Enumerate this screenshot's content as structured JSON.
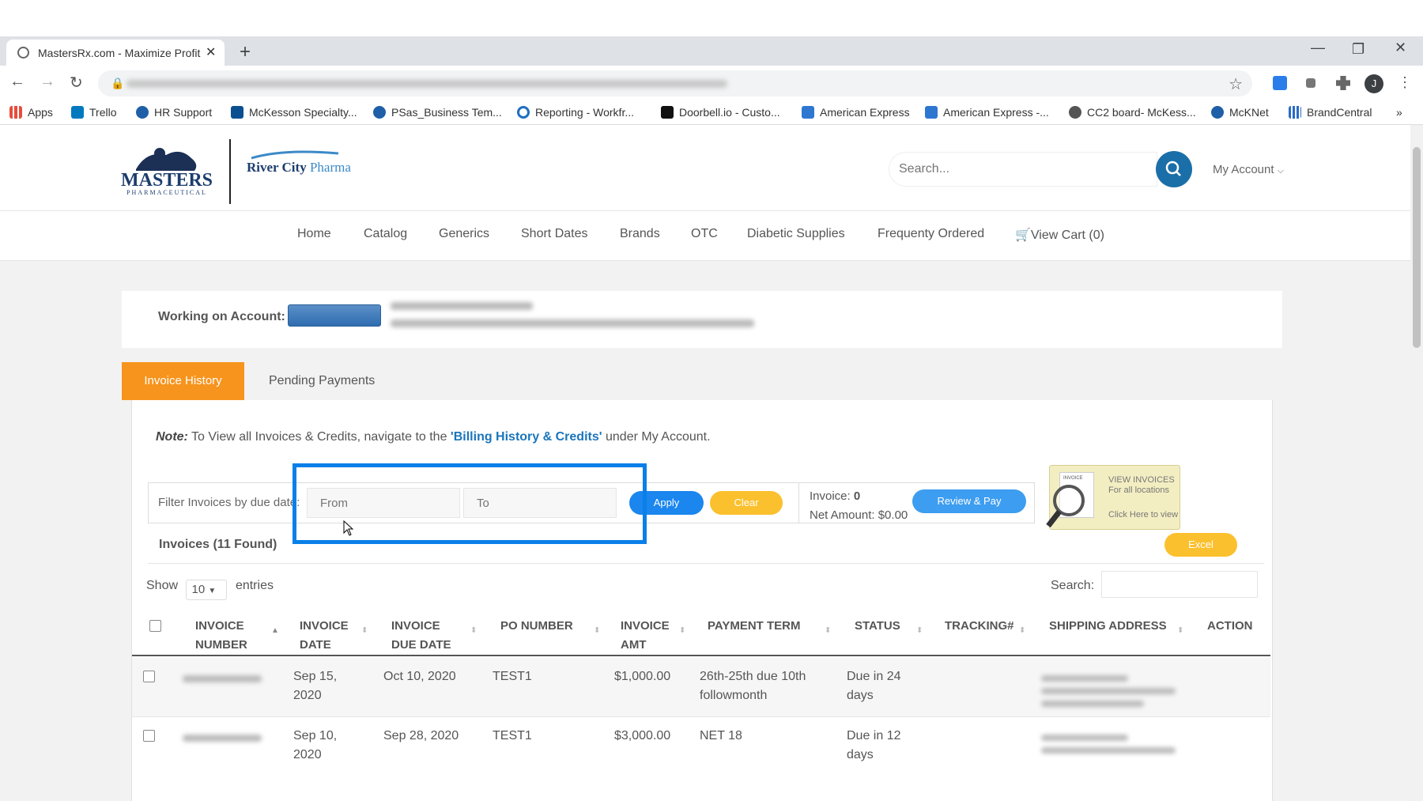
{
  "browser": {
    "tab_title": "MastersRx.com - Maximize Profit",
    "new_tab": "+",
    "close": "✕",
    "avatar_initial": "J",
    "bookmarks": [
      "Apps",
      "Trello",
      "HR Support",
      "McKesson Specialty...",
      "PSas_Business Tem...",
      "Reporting - Workfr...",
      "Doorbell.io - Custo...",
      "American Express",
      "American Express -...",
      "CC2 board- McKess...",
      "McKNet",
      "BrandCentral"
    ],
    "more_bookmarks": "»"
  },
  "header": {
    "logo_masters": "MASTERS",
    "logo_masters_sub": "PHARMACEUTICAL",
    "logo_rivercity_a": "River City",
    "logo_rivercity_b": "Pharma",
    "search_placeholder": "Search...",
    "my_account": "My Account"
  },
  "nav": [
    "Home",
    "Catalog",
    "Generics",
    "Short Dates",
    "Brands",
    "OTC",
    "Diabetic Supplies",
    "Frequenty Ordered",
    "View Cart (0)"
  ],
  "account": {
    "label": "Working on Account:"
  },
  "tabs": {
    "active": "Invoice History",
    "other": "Pending Payments"
  },
  "note": {
    "prefix": "Note:",
    "text_before": " To View all Invoices & Credits, navigate to the ",
    "link": "'Billing History & Credits'",
    "text_after": " under My Account."
  },
  "filter": {
    "label": "Filter Invoices by due date:",
    "from_placeholder": "From",
    "to_placeholder": "To",
    "apply": "Apply",
    "clear": "Clear",
    "invoice_label": "Invoice:",
    "invoice_count": "0",
    "net_amount": "Net Amount: $0.00",
    "review_pay": "Review & Pay",
    "view_invoices_line1": "VIEW INVOICES",
    "view_invoices_line2": "For all locations",
    "view_invoices_line3": "Click Here to view",
    "view_invoices_badge": "INVOICE"
  },
  "invoices": {
    "found": "Invoices (11 Found)",
    "excel": "Excel",
    "show": "Show",
    "entries_value": "10",
    "entries": "entries",
    "search_label": "Search:"
  },
  "table": {
    "headers": [
      [
        "INVOICE",
        "NUMBER"
      ],
      [
        "INVOICE",
        "DATE"
      ],
      [
        "INVOICE",
        "DUE DATE"
      ],
      [
        "PO NUMBER",
        ""
      ],
      [
        "INVOICE",
        "AMT"
      ],
      [
        "PAYMENT TERM",
        ""
      ],
      [
        "STATUS",
        ""
      ],
      [
        "TRACKING#",
        ""
      ],
      [
        "SHIPPING ADDRESS",
        ""
      ],
      [
        "ACTION",
        ""
      ]
    ],
    "rows": [
      {
        "date_a": "Sep 15,",
        "date_b": "2020",
        "due": "Oct 10, 2020",
        "po": "TEST1",
        "amt": "$1,000.00",
        "term_a": "26th-25th due 10th",
        "term_b": "followmonth",
        "status_a": "Due in 24",
        "status_b": "days"
      },
      {
        "date_a": "Sep 10,",
        "date_b": "2020",
        "due": "Sep 28, 2020",
        "po": "TEST1",
        "amt": "$3,000.00",
        "term_a": "NET 18",
        "term_b": "",
        "status_a": "Due in 12",
        "status_b": "days"
      }
    ]
  }
}
